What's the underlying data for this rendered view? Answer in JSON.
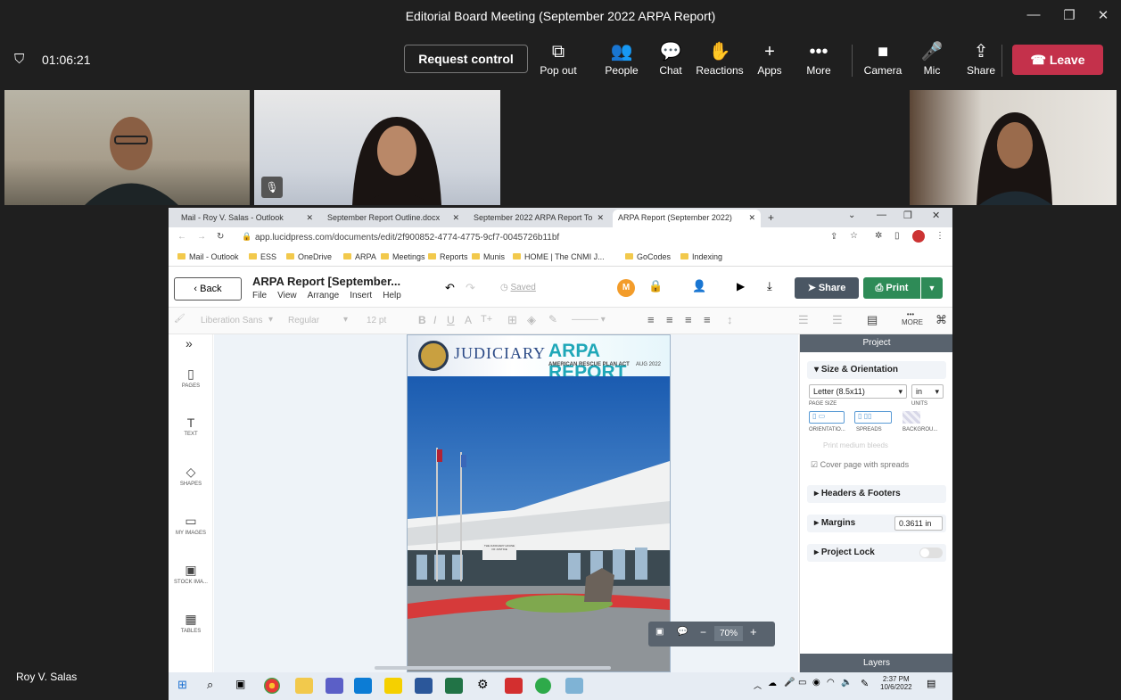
{
  "window": {
    "title": "Editorial Board Meeting (September 2022 ARPA Report)"
  },
  "meeting": {
    "timer": "01:06:21",
    "request_control": "Request control",
    "toolbar": [
      {
        "name": "pop-out",
        "label": "Pop out",
        "icon": "⧉"
      },
      {
        "name": "people",
        "label": "People",
        "icon": "👥"
      },
      {
        "name": "chat",
        "label": "Chat",
        "icon": "💬"
      },
      {
        "name": "reactions",
        "label": "Reactions",
        "icon": "✋"
      },
      {
        "name": "apps",
        "label": "Apps",
        "icon": "+"
      },
      {
        "name": "more",
        "label": "More",
        "icon": "•••"
      },
      {
        "name": "camera",
        "label": "Camera",
        "icon": "■"
      },
      {
        "name": "mic",
        "label": "Mic",
        "icon": "🎤"
      },
      {
        "name": "share",
        "label": "Share",
        "icon": "⇪"
      }
    ],
    "leave": "Leave",
    "presenter_name": "Roy V. Salas"
  },
  "browser": {
    "tabs": [
      {
        "label": "Mail - Roy V. Salas - Outlook",
        "active": false
      },
      {
        "label": "September Report Outline.docx",
        "active": false
      },
      {
        "label": "September 2022 ARPA Report To",
        "active": false
      },
      {
        "label": "ARPA Report (September 2022)",
        "active": true
      }
    ],
    "url": "app.lucidpress.com/documents/edit/2f900852-4774-4775-9cf7-0045726b11bf",
    "bookmarks": [
      "Mail - Outlook",
      "ESS",
      "OneDrive",
      "ARPA",
      "Meetings",
      "Reports",
      "Munis",
      "HOME | The CNMI J...",
      "GoCodes",
      "Indexing"
    ]
  },
  "app": {
    "back": "Back",
    "doc_title": "ARPA Report [September...",
    "menus": [
      "File",
      "View",
      "Arrange",
      "Insert",
      "Help"
    ],
    "saved": "Saved",
    "avatar": "M",
    "share": "Share",
    "print": "Print",
    "font": "Liberation Sans",
    "weight": "Regular",
    "size": "12 pt",
    "more": "MORE",
    "rail": [
      {
        "label": "PAGES",
        "icon": "▯"
      },
      {
        "label": "TEXT",
        "icon": "T"
      },
      {
        "label": "SHAPES",
        "icon": "◇"
      },
      {
        "label": "MY IMAGES",
        "icon": "▭"
      },
      {
        "label": "STOCK IMA...",
        "icon": "▣"
      },
      {
        "label": "TABLES",
        "icon": "▦"
      }
    ],
    "cover": {
      "org": "JUDICIARY",
      "report": "ARPA REPORT",
      "subtitle": "AMERICAN RESCUE PLAN ACT",
      "date": "AUG 2022",
      "sign": "THE JUDICIARY HOUSE OF JUSTICE"
    },
    "zoom": "70%",
    "panel": {
      "title": "Project",
      "size_orientation": "Size & Orientation",
      "page_size_value": "Letter (8.5x11)",
      "page_size_label": "PAGE SIZE",
      "units_value": "in",
      "units_label": "UNITS",
      "orientation_label": "ORIENTATIO...",
      "spreads_label": "SPREADS",
      "background_label": "BACKGROU...",
      "print_bleed": "Print medium bleeds",
      "cover_spreads": "Cover page with spreads",
      "headers_footers": "Headers & Footers",
      "margins": "Margins",
      "margins_value": "0.3611 in",
      "project_lock": "Project Lock",
      "layers": "Layers"
    }
  },
  "taskbar": {
    "time": "2:37 PM",
    "date": "10/6/2022"
  },
  "colors": {
    "leave": "#c4314b",
    "share_btn": "#4a5663",
    "print_btn": "#2e8b57",
    "accent_teal": "#1fa7b8"
  }
}
